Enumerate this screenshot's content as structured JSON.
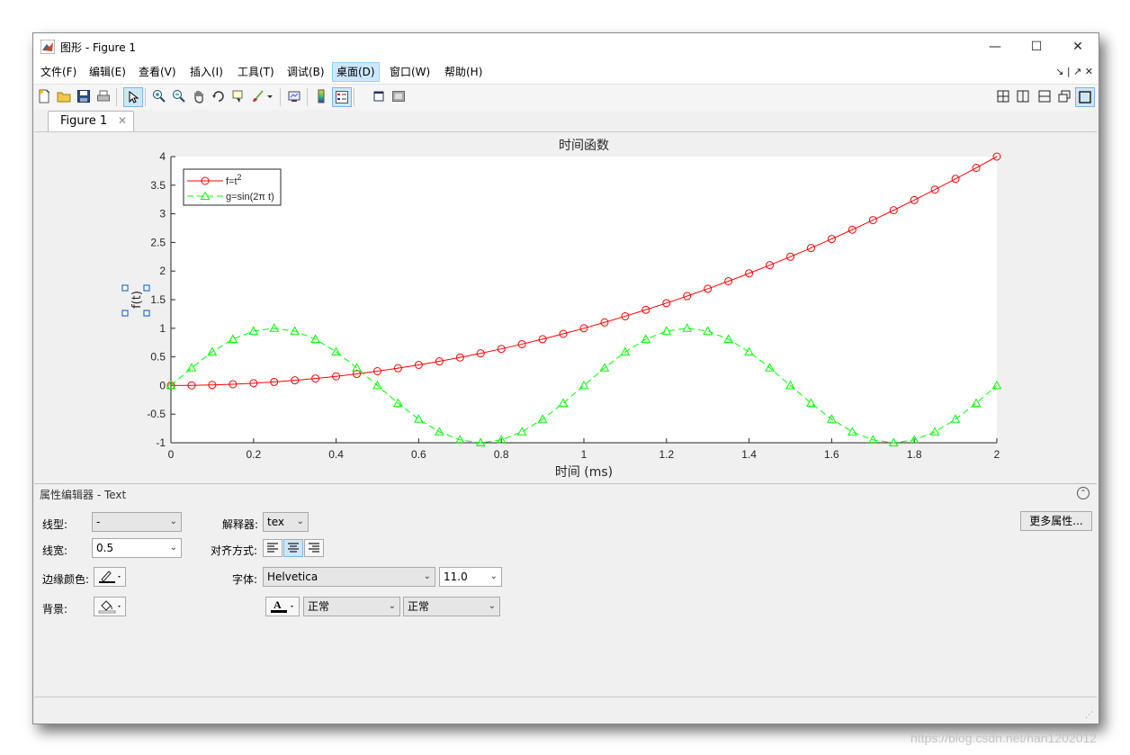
{
  "window": {
    "title": "图形 - Figure 1",
    "minimize": "—",
    "maximize": "☐",
    "close": "✕"
  },
  "menu": {
    "items": [
      "文件(F)",
      "编辑(E)",
      "查看(V)",
      "插入(I)",
      "工具(T)",
      "调试(B)",
      "桌面(D)",
      "窗口(W)",
      "帮助(H)"
    ],
    "active_index": 6,
    "right_controls": "↘ | ↗ ✕"
  },
  "toolbar": {
    "left_icons": [
      "new-figure-icon",
      "open-file-icon",
      "save-icon",
      "print-icon",
      "select-arrow-icon",
      "zoom-in-icon",
      "zoom-out-icon",
      "pan-hand-icon",
      "rotate-3d-icon",
      "data-cursor-icon",
      "brush-icon",
      "brush-dropdown-icon",
      "link-plot-icon",
      "colorbar-icon",
      "legend-icon",
      "hide-plot-tools-icon",
      "show-plot-tools-icon"
    ],
    "right_icons": [
      "tile-grid-icon",
      "tile-columns-icon",
      "tile-rows-icon",
      "float-icon",
      "maximize-icon"
    ]
  },
  "tab": {
    "label": "Figure 1",
    "close": "✕"
  },
  "chart_data": {
    "type": "line",
    "title": "时间函数",
    "xlabel": "时间 (ms)",
    "ylabel": "f(t)",
    "xlim": [
      0,
      2
    ],
    "ylim": [
      -1,
      4
    ],
    "xticks": [
      "0",
      "0.2",
      "0.4",
      "0.6",
      "0.8",
      "1",
      "1.2",
      "1.4",
      "1.6",
      "1.8",
      "2"
    ],
    "yticks": [
      "-1",
      "-0.5",
      "0",
      "0.5",
      "1",
      "1.5",
      "2",
      "2.5",
      "3",
      "3.5",
      "4"
    ],
    "grid": false,
    "legend_position": "top-left",
    "x": [
      0,
      0.05,
      0.1,
      0.15,
      0.2,
      0.25,
      0.3,
      0.35,
      0.4,
      0.45,
      0.5,
      0.55,
      0.6,
      0.65,
      0.7,
      0.75,
      0.8,
      0.85,
      0.9,
      0.95,
      1,
      1.05,
      1.1,
      1.15,
      1.2,
      1.25,
      1.3,
      1.35,
      1.4,
      1.45,
      1.5,
      1.55,
      1.6,
      1.65,
      1.7,
      1.75,
      1.8,
      1.85,
      1.9,
      1.95,
      2
    ],
    "series": [
      {
        "name": "f=t²",
        "legend_main": "f=t",
        "legend_sup": "2",
        "color": "#ff0000",
        "line": "solid",
        "marker": "circle",
        "values": [
          0,
          0.0025,
          0.01,
          0.0225,
          0.04,
          0.0625,
          0.09,
          0.1225,
          0.16,
          0.2025,
          0.25,
          0.3025,
          0.36,
          0.4225,
          0.49,
          0.5625,
          0.64,
          0.7225,
          0.81,
          0.9025,
          1,
          1.1025,
          1.21,
          1.3225,
          1.44,
          1.5625,
          1.69,
          1.8225,
          1.96,
          2.1025,
          2.25,
          2.4025,
          2.56,
          2.7225,
          2.89,
          3.0625,
          3.24,
          3.4225,
          3.61,
          3.8025,
          4
        ]
      },
      {
        "name": "g=sin(2π t)",
        "color": "#00ff00",
        "line": "dashed",
        "marker": "triangle",
        "values": [
          0,
          0.309,
          0.588,
          0.809,
          0.951,
          1,
          0.951,
          0.809,
          0.588,
          0.309,
          0,
          -0.309,
          -0.588,
          -0.809,
          -0.951,
          -1,
          -0.951,
          -0.809,
          -0.588,
          -0.309,
          0,
          0.309,
          0.588,
          0.809,
          0.951,
          1,
          0.951,
          0.809,
          0.588,
          0.309,
          0,
          -0.309,
          -0.588,
          -0.809,
          -0.951,
          -1,
          -0.951,
          -0.809,
          -0.588,
          -0.309,
          0
        ]
      }
    ]
  },
  "property_editor": {
    "title": "属性编辑器 - Text",
    "collapse": "⌃",
    "line_style_label": "线型:",
    "line_style_value": "-",
    "line_width_label": "线宽:",
    "line_width_value": "0.5",
    "edge_color_label": "边缘颜色:",
    "background_label": "背景:",
    "interpreter_label": "解释器:",
    "interpreter_value": "tex",
    "alignment_label": "对齐方式:",
    "font_label": "字体:",
    "font_name_value": "Helvetica",
    "font_size_value": "11.0",
    "font_weight_value": "正常",
    "font_angle_value": "正常",
    "more_props_label": "更多属性..."
  },
  "watermark": "https://blog.csdn.net/han1202012"
}
